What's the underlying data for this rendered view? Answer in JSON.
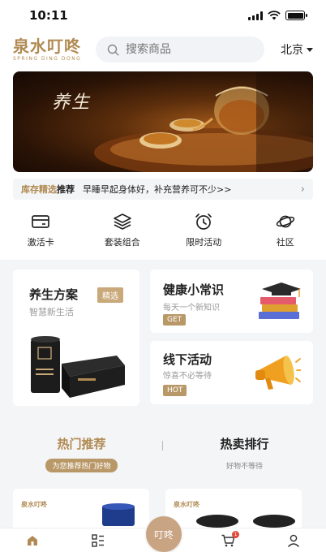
{
  "status_bar": {
    "time": "10:11"
  },
  "header": {
    "logo_cn": "泉水叮咚",
    "logo_en": "SPRING DING DONG",
    "search_placeholder": "搜索商品",
    "city": "北京"
  },
  "banner": {
    "title": "养生"
  },
  "notice": {
    "tag_part1": "库存精选",
    "tag_part2": "推荐",
    "text": "早睡早起身体好，补充营养可不少>>"
  },
  "quick_menu": [
    {
      "label": "激活卡",
      "icon": "card-icon"
    },
    {
      "label": "套装组合",
      "icon": "layers-icon"
    },
    {
      "label": "限时活动",
      "icon": "alarm-clock-icon"
    },
    {
      "label": "社区",
      "icon": "planet-icon"
    }
  ],
  "features": {
    "plan": {
      "title": "养生方案",
      "badge": "精选",
      "subtitle": "智慧新生活"
    },
    "health": {
      "title": "健康小常识",
      "subtitle": "每天一个新知识",
      "tag": "GET"
    },
    "offline": {
      "title": "线下活动",
      "subtitle": "惊喜不必等待",
      "tag": "HOT"
    }
  },
  "hot": {
    "tabs": [
      {
        "title": "热门推荐",
        "subtitle": "为您推荐热门好物"
      },
      {
        "title": "热卖排行",
        "subtitle": "好物不等待"
      }
    ],
    "products": [
      {
        "brand": "泉水叮咚"
      },
      {
        "brand": "泉水叮咚"
      }
    ]
  },
  "tab_bar": {
    "items": [
      "home-icon",
      "category-icon",
      "center-button",
      "cart-icon",
      "user-icon"
    ],
    "cart_count": "1",
    "center_label": "叮咚"
  },
  "colors": {
    "accent": "#b08a52",
    "tag_bg": "#b99868",
    "bg_gray": "#f4f5f7"
  }
}
